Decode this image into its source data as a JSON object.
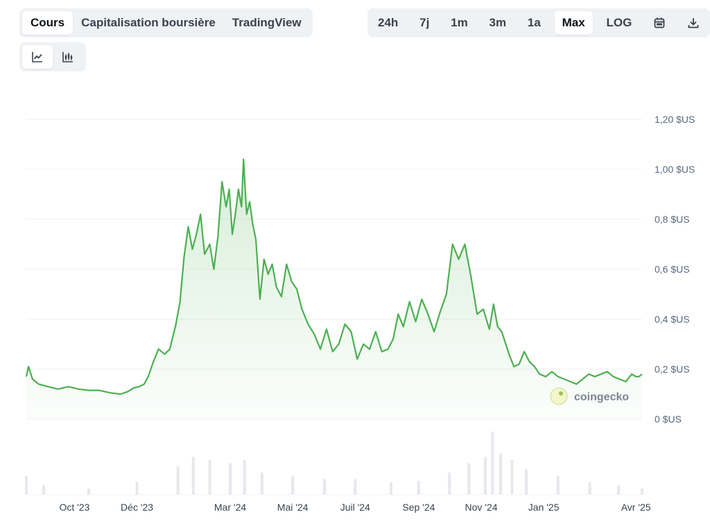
{
  "tabs": [
    {
      "label": "Cours",
      "active": true
    },
    {
      "label": "Capitalisation boursière",
      "active": false
    },
    {
      "label": "TradingView",
      "active": false
    }
  ],
  "ranges": [
    {
      "label": "24h",
      "active": false
    },
    {
      "label": "7j",
      "active": false
    },
    {
      "label": "1m",
      "active": false
    },
    {
      "label": "3m",
      "active": false
    },
    {
      "label": "1a",
      "active": false
    },
    {
      "label": "Max",
      "active": true
    },
    {
      "label": "LOG",
      "active": false
    }
  ],
  "icons": {
    "calendar": "calendar-icon",
    "download": "download-icon",
    "line": "line-chart-icon",
    "candle": "candlestick-icon"
  },
  "watermark": "coingecko",
  "chart_data": {
    "type": "area",
    "line_color": "#4caf50",
    "fill_color": "#e7f5e8",
    "ylim": [
      0,
      1.2
    ],
    "y_ticks": [
      0,
      0.2,
      0.4,
      0.6,
      0.8,
      1.0,
      1.2
    ],
    "y_tick_labels": [
      "0 $US",
      "0,2 $US",
      "0,4 $US",
      "0,6 $US",
      "0,8 $US",
      "1,00 $US",
      "1,20 $US"
    ],
    "x_range": [
      "2023-08-15",
      "2025-04-07"
    ],
    "x_ticks": [
      {
        "date": "2023-10-01",
        "label": "Oct '23"
      },
      {
        "date": "2023-12-01",
        "label": "Déc '23"
      },
      {
        "date": "2024-03-01",
        "label": "Mar '24"
      },
      {
        "date": "2024-05-01",
        "label": "Mai '24"
      },
      {
        "date": "2024-07-01",
        "label": "Juil '24"
      },
      {
        "date": "2024-09-01",
        "label": "Sep '24"
      },
      {
        "date": "2024-11-01",
        "label": "Nov '24"
      },
      {
        "date": "2025-01-01",
        "label": "Jan '25"
      },
      {
        "date": "2025-04-01",
        "label": "Avr '25"
      }
    ],
    "series": [
      {
        "x": [
          "2023-08-15",
          "2023-08-17",
          "2023-08-21",
          "2023-08-27",
          "2023-09-05",
          "2023-09-15",
          "2023-09-25",
          "2023-10-05",
          "2023-10-15",
          "2023-10-25",
          "2023-11-05",
          "2023-11-15",
          "2023-11-22",
          "2023-11-28",
          "2023-12-03",
          "2023-12-08",
          "2023-12-12",
          "2023-12-17",
          "2023-12-22",
          "2023-12-28",
          "2024-01-02",
          "2024-01-08",
          "2024-01-12",
          "2024-01-16",
          "2024-01-20",
          "2024-01-24",
          "2024-01-28",
          "2024-02-01",
          "2024-02-05",
          "2024-02-10",
          "2024-02-14",
          "2024-02-18",
          "2024-02-22",
          "2024-02-26",
          "2024-02-29",
          "2024-03-03",
          "2024-03-06",
          "2024-03-09",
          "2024-03-12",
          "2024-03-14",
          "2024-03-17",
          "2024-03-20",
          "2024-03-23",
          "2024-03-26",
          "2024-03-30",
          "2024-04-03",
          "2024-04-07",
          "2024-04-11",
          "2024-04-15",
          "2024-04-20",
          "2024-04-25",
          "2024-04-30",
          "2024-05-05",
          "2024-05-10",
          "2024-05-16",
          "2024-05-22",
          "2024-05-28",
          "2024-06-03",
          "2024-06-09",
          "2024-06-15",
          "2024-06-21",
          "2024-06-27",
          "2024-07-03",
          "2024-07-09",
          "2024-07-15",
          "2024-07-21",
          "2024-07-27",
          "2024-08-02",
          "2024-08-07",
          "2024-08-12",
          "2024-08-17",
          "2024-08-23",
          "2024-08-29",
          "2024-09-04",
          "2024-09-10",
          "2024-09-16",
          "2024-09-22",
          "2024-09-28",
          "2024-10-04",
          "2024-10-10",
          "2024-10-16",
          "2024-10-22",
          "2024-10-28",
          "2024-11-03",
          "2024-11-09",
          "2024-11-13",
          "2024-11-17",
          "2024-11-21",
          "2024-11-25",
          "2024-11-29",
          "2024-12-03",
          "2024-12-08",
          "2024-12-13",
          "2024-12-18",
          "2024-12-23",
          "2024-12-28",
          "2025-01-03",
          "2025-01-09",
          "2025-01-15",
          "2025-01-21",
          "2025-01-27",
          "2025-02-02",
          "2025-02-08",
          "2025-02-14",
          "2025-02-20",
          "2025-02-26",
          "2025-03-04",
          "2025-03-10",
          "2025-03-16",
          "2025-03-22",
          "2025-03-28",
          "2025-04-01",
          "2025-04-04",
          "2025-04-07"
        ],
        "values": [
          0.17,
          0.21,
          0.16,
          0.14,
          0.13,
          0.12,
          0.13,
          0.12,
          0.115,
          0.115,
          0.105,
          0.1,
          0.11,
          0.125,
          0.13,
          0.14,
          0.17,
          0.23,
          0.28,
          0.26,
          0.28,
          0.38,
          0.47,
          0.65,
          0.77,
          0.68,
          0.74,
          0.82,
          0.66,
          0.7,
          0.6,
          0.73,
          0.95,
          0.85,
          0.92,
          0.74,
          0.82,
          0.92,
          0.85,
          1.04,
          0.82,
          0.87,
          0.78,
          0.72,
          0.48,
          0.64,
          0.58,
          0.62,
          0.53,
          0.49,
          0.62,
          0.55,
          0.52,
          0.44,
          0.38,
          0.34,
          0.28,
          0.36,
          0.27,
          0.3,
          0.38,
          0.35,
          0.24,
          0.3,
          0.28,
          0.35,
          0.27,
          0.28,
          0.32,
          0.42,
          0.37,
          0.47,
          0.39,
          0.48,
          0.42,
          0.35,
          0.43,
          0.5,
          0.7,
          0.64,
          0.7,
          0.57,
          0.42,
          0.44,
          0.36,
          0.46,
          0.37,
          0.35,
          0.3,
          0.25,
          0.21,
          0.22,
          0.27,
          0.23,
          0.21,
          0.18,
          0.17,
          0.19,
          0.17,
          0.16,
          0.15,
          0.14,
          0.16,
          0.18,
          0.17,
          0.18,
          0.19,
          0.17,
          0.16,
          0.15,
          0.18,
          0.17,
          0.17,
          0.18
        ]
      }
    ],
    "volume": {
      "color": "#e6e8ec",
      "x": [
        "2023-08-15",
        "2023-09-01",
        "2023-10-15",
        "2023-12-01",
        "2024-01-10",
        "2024-01-25",
        "2024-02-10",
        "2024-03-01",
        "2024-03-15",
        "2024-04-01",
        "2024-05-01",
        "2024-06-01",
        "2024-07-01",
        "2024-08-05",
        "2024-09-01",
        "2024-10-01",
        "2024-10-20",
        "2024-11-05",
        "2024-11-12",
        "2024-11-20",
        "2024-12-01",
        "2024-12-15",
        "2025-01-15",
        "2025-02-15",
        "2025-03-15",
        "2025-04-07"
      ],
      "values": [
        0.3,
        0.15,
        0.1,
        0.2,
        0.45,
        0.6,
        0.55,
        0.5,
        0.55,
        0.35,
        0.3,
        0.25,
        0.25,
        0.2,
        0.22,
        0.35,
        0.5,
        0.6,
        1.0,
        0.65,
        0.55,
        0.4,
        0.3,
        0.2,
        0.15,
        0.1
      ]
    }
  }
}
